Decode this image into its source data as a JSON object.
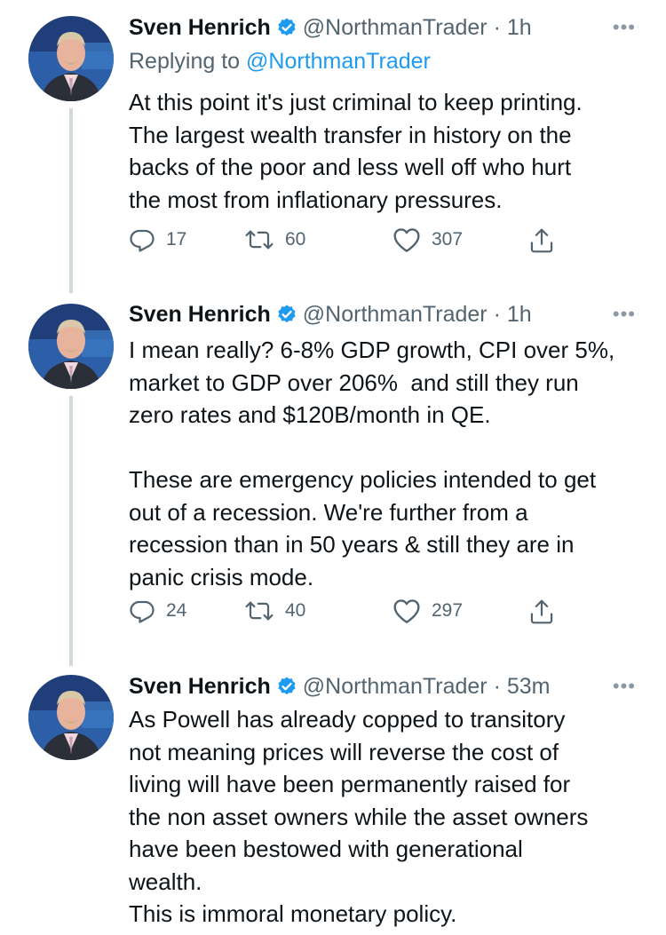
{
  "tweets": [
    {
      "author": "Sven Henrich",
      "handle": "@NorthmanTrader",
      "time": "1h",
      "replying_label": "Replying to",
      "replying_handle": "@NorthmanTrader",
      "text": "At this point it's just criminal to keep printing.\nThe largest wealth transfer in history on the\nbacks of the poor and less well off who hurt\nthe most from inflationary pressures.",
      "replies": "17",
      "retweets": "60",
      "likes": "307"
    },
    {
      "author": "Sven Henrich",
      "handle": "@NorthmanTrader",
      "time": "1h",
      "text": "I mean really? 6-8% GDP growth, CPI over 5%,\nmarket to GDP over 206%  and still they run\nzero rates and $120B/month in QE.\n\nThese are emergency policies intended to get\nout of a recession. We're further from a\nrecession than in 50 years & still they are in\npanic crisis mode.",
      "replies": "24",
      "retweets": "40",
      "likes": "297"
    },
    {
      "author": "Sven Henrich",
      "handle": "@NorthmanTrader",
      "time": "53m",
      "text": "As Powell has already copped to transitory\nnot meaning prices will reverse the cost of\nliving will have been permanently raised for\nthe non asset owners while the asset owners\nhave been bestowed with generational\nwealth.\nThis is immoral monetary policy."
    }
  ],
  "separator": " · ",
  "icons": {
    "verified": "verified-badge-icon",
    "more": "more-options-icon",
    "reply": "reply-icon",
    "retweet": "retweet-icon",
    "like": "heart-icon",
    "share": "share-icon"
  },
  "colors": {
    "text": "#0f1419",
    "secondary": "#536471",
    "link": "#1d9bf0",
    "verified": "#1d9bf0",
    "thread_line": "#cfd9de"
  }
}
